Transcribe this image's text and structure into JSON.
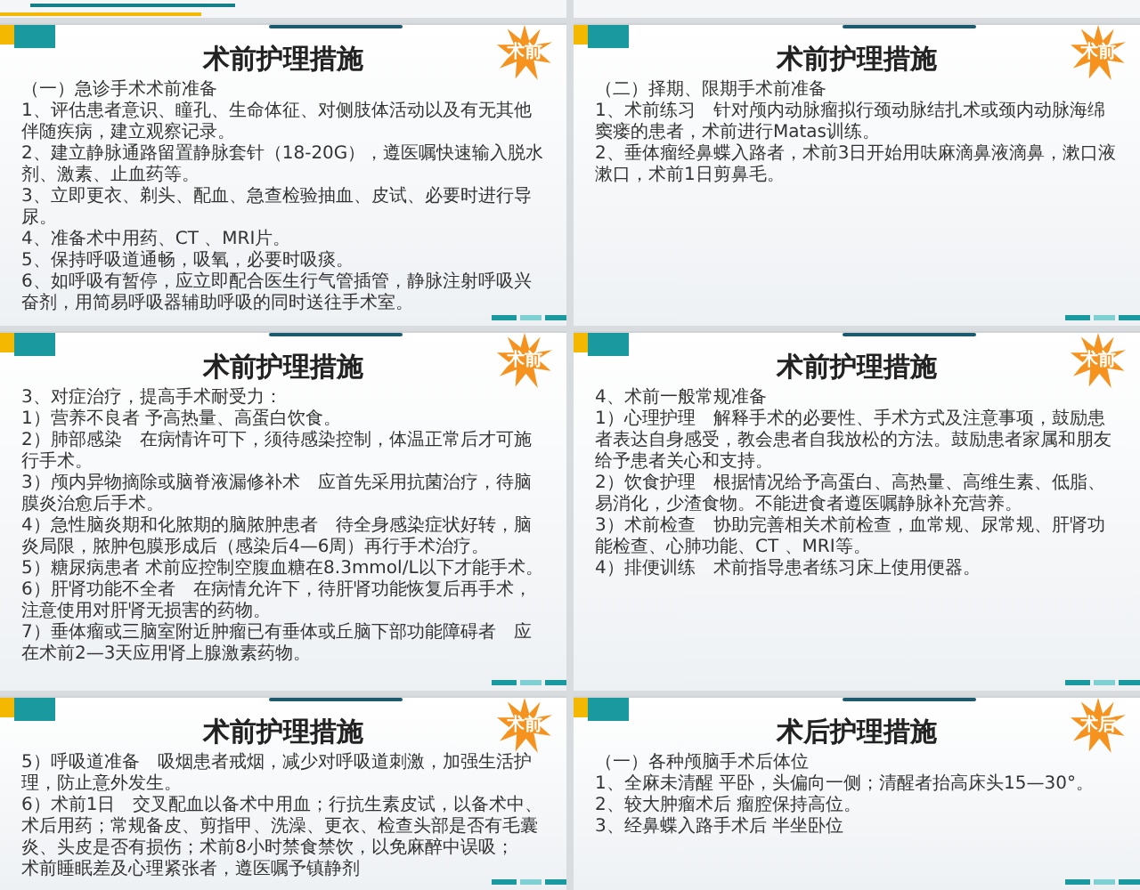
{
  "slides": [
    {
      "title": "术前护理措施",
      "badge": "术前",
      "paragraphs": [
        "（一）急诊手术术前准备",
        "1、评估患者意识、瞳孔、生命体征、对侧肢体活动以及有无其他伴随疾病，建立观察记录。",
        "2、建立静脉通路留置静脉套针（18-20G），遵医嘱快速输入脱水剂、激素、止血药等。",
        "3、立即更衣、剃头、配血、急查检验抽血、皮试、必要时进行导尿。",
        "4、准备术中用药、CT 、MRI片。",
        "5、保持呼吸道通畅，吸氧，必要时吸痰。",
        "6、如呼吸有暂停，应立即配合医生行气管插管，静脉注射呼吸兴奋剂，用简易呼吸器辅助呼吸的同时送往手术室。"
      ]
    },
    {
      "title": "术前护理措施",
      "badge": "术前",
      "paragraphs": [
        "（二）择期、限期手术前准备",
        "1、术前练习　针对颅内动脉瘤拟行颈动脉结扎术或颈内动脉海绵窦瘘的患者，术前进行Matas训练。",
        "2、垂体瘤经鼻蝶入路者，术前3日开始用呋麻滴鼻液滴鼻，漱口液漱口，术前1日剪鼻毛。"
      ]
    },
    {
      "title": "术前护理措施",
      "badge": "术前",
      "paragraphs": [
        "3、对症治疗，提高手术耐受力：",
        "1）营养不良者 予高热量、高蛋白饮食。",
        "2）肺部感染　在病情许可下，须待感染控制，体温正常后才可施行手术。",
        "3）颅内异物摘除或脑脊液漏修补术　应首先采用抗菌治疗，待脑膜炎治愈后手术。",
        "4）急性脑炎期和化脓期的脑脓肿患者　待全身感染症状好转，脑炎局限，脓肿包膜形成后（感染后4—6周）再行手术治疗。",
        "5）糖尿病患者 术前应控制空腹血糖在8.3mmol/L以下才能手术。",
        "6）肝肾功能不全者　在病情允许下，待肝肾功能恢复后再手术，注意使用对肝肾无损害的药物。",
        "7）垂体瘤或三脑室附近肿瘤已有垂体或丘脑下部功能障碍者　应在术前2—3天应用肾上腺激素药物。"
      ]
    },
    {
      "title": "术前护理措施",
      "badge": "术前",
      "paragraphs": [
        "4、术前一般常规准备",
        "1）心理护理　解释手术的必要性、手术方式及注意事项，鼓励患者表达自身感受，教会患者自我放松的方法。鼓励患者家属和朋友给予患者关心和支持。",
        "2）饮食护理　根据情况给予高蛋白、高热量、高维生素、低脂、易消化，少渣食物。不能进食者遵医嘱静脉补充营养。",
        "3）术前检查　协助完善相关术前检查，血常规、尿常规、肝肾功能检查、心肺功能、CT 、MRI等。",
        "4）排便训练　术前指导患者练习床上使用便器。"
      ]
    },
    {
      "title": "术前护理措施",
      "badge": "术前",
      "paragraphs": [
        "5）呼吸道准备　吸烟患者戒烟，减少对呼吸道刺激，加强生活护理，防止意外发生。",
        "6）术前1日　交叉配血以备术中用血；行抗生素皮试，以备术中、术后用药；常规备皮、剪指甲、洗澡、更衣、检查头部是否有毛囊炎、头皮是否有损伤；术前8小时禁食禁饮，以免麻醉中误吸；",
        "术前睡眠差及心理紧张者，遵医嘱予镇静剂"
      ]
    },
    {
      "title": "术后护理措施",
      "badge": "术后",
      "paragraphs": [
        "（一）各种颅脑手术后体位",
        "1、全麻未清醒 平卧，头偏向一侧；清醒者抬高床头15—30°。",
        "2、较大肿瘤术后 瘤腔保持高位。",
        "3、经鼻蝶入路手术后 半坐卧位"
      ]
    }
  ]
}
